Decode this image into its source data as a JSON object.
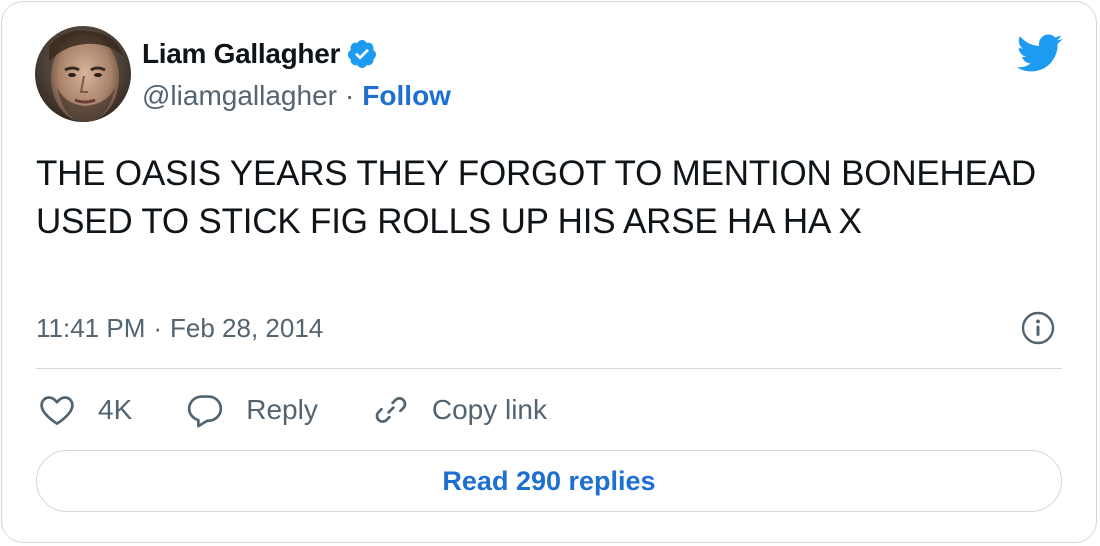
{
  "author": {
    "display_name": "Liam Gallagher",
    "handle": "@liamgallagher",
    "separator": "·",
    "follow_label": "Follow",
    "verified": true
  },
  "tweet": {
    "text": "THE OASIS YEARS THEY FORGOT TO MENTION BONEHEAD USED TO STICK FIG ROLLS UP HIS ARSE HA HA X",
    "time": "11:41 PM",
    "separator": "·",
    "date": "Feb 28, 2014"
  },
  "actions": {
    "like_count": "4K",
    "reply_label": "Reply",
    "copy_link_label": "Copy link"
  },
  "read_replies_label": "Read 290 replies",
  "icons": {
    "brand": "twitter-bird-icon",
    "verified": "verified-badge-icon",
    "info": "info-icon",
    "like": "heart-icon",
    "reply": "speech-bubble-icon",
    "copy": "link-icon"
  },
  "colors": {
    "accent": "#1d9bf0",
    "link": "#1d6fd1",
    "text": "#0f1419",
    "muted": "#536471",
    "border": "#cfd9de"
  }
}
